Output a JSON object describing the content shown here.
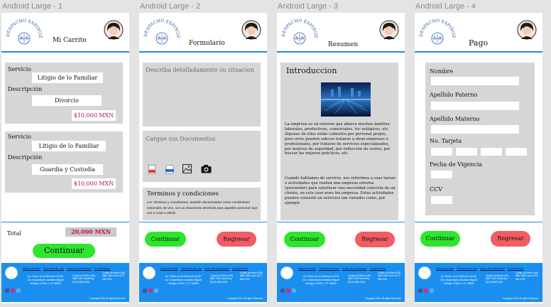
{
  "frames": [
    {
      "title": "Android Large - 1"
    },
    {
      "title": "Android Large - 2"
    },
    {
      "title": "Android Large - 3"
    },
    {
      "title": "Android Large - 4"
    }
  ],
  "logo_text": "DESPACHO ESPINOZA",
  "cart": {
    "title": "Mi Carrito",
    "items": [
      {
        "service_label": "Servicio",
        "service": "Litigio de lo Familiar",
        "desc_label": "Descripción",
        "desc": "Divorcio",
        "price": "$10,000  MXN"
      },
      {
        "service_label": "Servicio",
        "service": "Litigio de lo Familiar",
        "desc_label": "Descripción",
        "desc": "Guardia  y  Custodia",
        "price": "$10,000  MXN"
      }
    ],
    "total_label": "Total",
    "total_value": "20,000  MXN",
    "continue_label": "Continuar"
  },
  "form": {
    "title": "Formulario",
    "description_placeholder": "Describa detalladamente su situacion",
    "documents_label": "Cargue sus Documentos",
    "file_icons": [
      "pdf-icon",
      "doc-icon",
      "image-icon",
      "camera-icon"
    ],
    "terms_title": "Terminos y condiciones",
    "terms_text": "Los Términos y Condiciones, también denominados como Condiciones Generales de Uso, son un documento diseñado para aquellas personas que van a crear o admin",
    "continue_label": "Continuar",
    "back_label": "Regresar"
  },
  "summary": {
    "title": "Resumen",
    "intro_heading": "Introduccion",
    "intro_text_1": "La empresa es un entorno que abarca muchos ámbitos: laborales, productivos, comerciales, tec  nológicos, etc. Algunos de ellos están cubiertos por personal propio, pero otros pueden subcon  tratarse a otras empresas o profesionales, por tratarse de servicios especializados, por motivos de seguridad, por reducción de costes, por buscar las mejores prácticas, etc.",
    "intro_text_2": "Cuando hablamos de servicio, nos referimos a esas tareas o actividades que realiza una empresa externa (proveedor) para satisfacer una necesidad concreta de un cliente, en este caso nues  tra empresa. Estas actividades pueden consistir en servicios tan variados como, por ejemplo",
    "continue_label": "Continuar",
    "back_label": "Regresar"
  },
  "payment": {
    "title": "Pago",
    "fields": [
      "Nombre",
      "Apellido Paterno",
      "Apellido Materno",
      "No.  Tarjeta",
      "Fecha de Vigencia",
      "CCV"
    ],
    "continue_label": "Continuar",
    "back_label": "Regresar"
  },
  "footer": {
    "links": [
      "Mapa del sitio",
      "Terminos de uso",
      "Aviso de privacidad",
      "Contactanos"
    ],
    "address": "Av. Paseo de la Reforma #1240 Col. chapultepec Alcaldía Miguel Hidalgo CDMX, C.P. 06600",
    "contact_a": "Ciudad de México (55) 8682 2304 Monterrey (81) 8 8682 5302",
    "contact_b": "Ciudad de México (55) 8682 2604 León (477) 584 2784",
    "copyright": "Copyright 2030, All rights Reserved."
  },
  "colors": {
    "accent": "#1e8be6",
    "footer": "#1a8ff0",
    "continue": "#2ee52e",
    "back": "#f25c63",
    "price": "#c0123c"
  }
}
